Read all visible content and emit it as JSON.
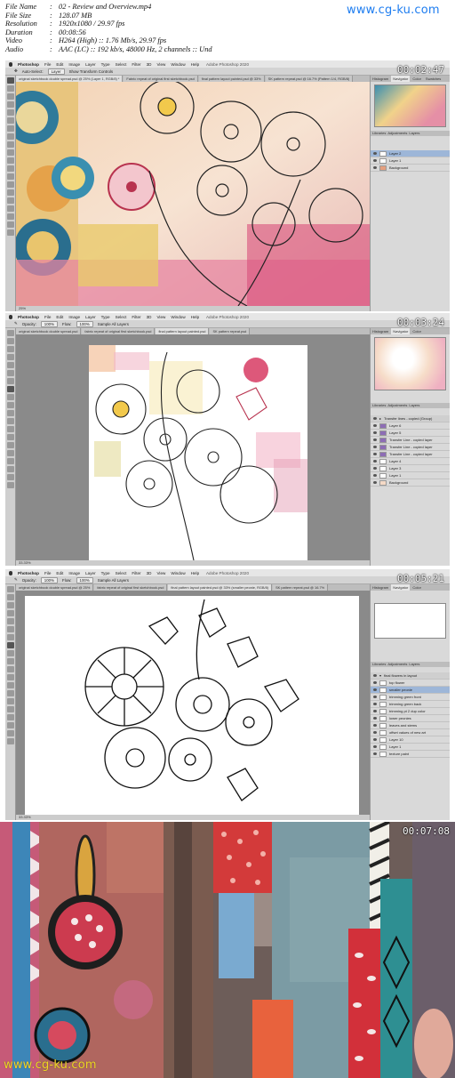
{
  "meta": {
    "rows": [
      {
        "key": "File Name",
        "value": "02 - Review and Overview.mp4"
      },
      {
        "key": "File Size",
        "value": "128.07 MB"
      },
      {
        "key": "Resolution",
        "value": "1920x1080 / 29.97 fps"
      },
      {
        "key": "Duration",
        "value": "00:08:56"
      },
      {
        "key": "Video",
        "value": "H264 (High) :: 1.76 Mb/s, 29.97 fps"
      },
      {
        "key": "Audio",
        "value": "AAC (LC) :: 192 kb/s, 48000 Hz, 2 channels :: Und"
      }
    ],
    "watermark_top": "www.cg-ku.com",
    "watermark_bottom": "www.cg-ku.com"
  },
  "frames": [
    {
      "timestamp": "00:02:47",
      "menu": [
        "Photoshop",
        "File",
        "Edit",
        "Image",
        "Layer",
        "Type",
        "Select",
        "Filter",
        "3D",
        "View",
        "Window",
        "Help"
      ],
      "title": "Adobe Photoshop 2020",
      "tabs": [
        "original sketchbook double spread.psd @ 25% (Layer 1, RGB/8) *",
        "Fabric repeat of original first sketchbook.psd",
        "final pattern layout painted.psd @ 33%",
        "SK pattern repeat.psd @ 16.7% (Pattern 1/4, RGB/8)"
      ],
      "options": [
        "Auto-Select:",
        "Layer",
        "Show Transform Controls"
      ],
      "panel_tabs": [
        "Histogram",
        "Navigator",
        "Color",
        "Swatches"
      ],
      "layer_tabs": [
        "Libraries",
        "Adjustments",
        "Layers"
      ],
      "layers": [
        "Layer 2",
        "Layer 1",
        "Background"
      ],
      "status": "25%"
    },
    {
      "timestamp": "00:03:24",
      "menu": [
        "Photoshop",
        "File",
        "Edit",
        "Image",
        "Layer",
        "Type",
        "Select",
        "Filter",
        "3D",
        "View",
        "Window",
        "Help"
      ],
      "title": "Adobe Photoshop 2020",
      "tabs": [
        "original sketchbook double spread.psd",
        "fabric repeat of original first sketchbook.psd",
        "final pattern layout painted.psd",
        "SK pattern repeat.psd"
      ],
      "options": [
        "Opacity:",
        "100%",
        "Flow:",
        "100%",
        "Sample All Layers"
      ],
      "panel_tabs": [
        "Histogram",
        "Navigator",
        "Color"
      ],
      "layer_tabs": [
        "Libraries",
        "Adjustments",
        "Layers"
      ],
      "layers": [
        "Transfer lines - copied (Group)",
        "Layer 6",
        "Layer 5",
        "Transfer Line - copied layer",
        "Transfer Line - copied layer",
        "Transfer Line - copied layer",
        "Layer 4",
        "Layer 3",
        "Layer 1",
        "Background"
      ],
      "status": "33.33%"
    },
    {
      "timestamp": "00:05:21",
      "menu": [
        "Photoshop",
        "File",
        "Edit",
        "Image",
        "Layer",
        "Type",
        "Select",
        "Filter",
        "3D",
        "View",
        "Window",
        "Help"
      ],
      "title": "Adobe Photoshop 2020",
      "tabs": [
        "original sketchbook double spread.psd @ 25%",
        "fabric repeat of original first sketchbook.psd",
        "final pattern layout painted.psd @ 33% (smaller peonie, RGB/8)",
        "SK pattern repeat.psd @ 16.7%"
      ],
      "options": [
        "Opacity:",
        "100%",
        "Flow:",
        "100%",
        "Sample All Layers"
      ],
      "panel_tabs": [
        "Histogram",
        "Navigator",
        "Color"
      ],
      "layer_tabs": [
        "Libraries",
        "Adjustments",
        "Layers"
      ],
      "layers": [
        "final flowers in layout",
        "top flower",
        "smaller peonie",
        "trimming green front",
        "trimming green back",
        "trimming pt 2 dup color",
        "lower peonies",
        "leaves and stems",
        "offset values of new art",
        "Layer 10",
        "Layer 1",
        "texture paint"
      ],
      "status": "33.33%"
    },
    {
      "timestamp": "00:07:08"
    }
  ]
}
